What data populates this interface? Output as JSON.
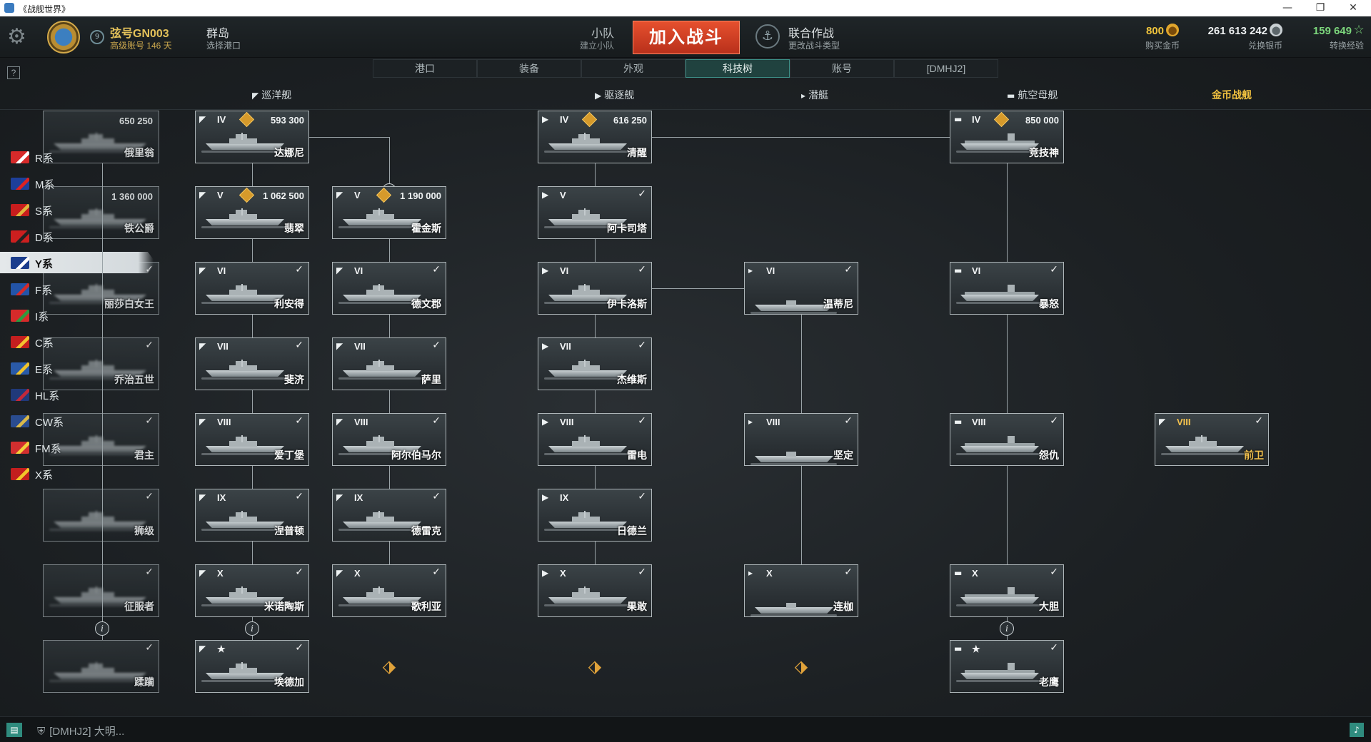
{
  "window": {
    "title": "《战舰世界》",
    "controls": [
      "—",
      "❐",
      "✕"
    ]
  },
  "header": {
    "player_name": "弦号GN003",
    "account_info": "高级账号 146 天",
    "port_name": "群岛",
    "port_sub": "选择港口",
    "division_label": "小队",
    "division_sub": "建立小队",
    "battle_button": "加入战斗",
    "ops_label": "联合作战",
    "ops_sub": "更改战斗类型",
    "gold_value": "800",
    "gold_label": "购买金币",
    "credits_value": "261 613 242",
    "credits_label": "兑换银币",
    "fxp_value": "159 649",
    "fxp_label": "转换经验"
  },
  "tabs": [
    {
      "label": "港口"
    },
    {
      "label": "装备"
    },
    {
      "label": "外观"
    },
    {
      "label": "科技树",
      "active": true
    },
    {
      "label": "账号"
    },
    {
      "label": "[DMHJ2]"
    }
  ],
  "help_label": "?",
  "class_headers": {
    "cruisers": "巡洋舰",
    "destroyers": "驱逐舰",
    "submarines": "潜艇",
    "carriers": "航空母舰",
    "premium": "金币战舰"
  },
  "nations": [
    {
      "label": "R系",
      "c1": "#d62a2a",
      "c2": "#ffffff"
    },
    {
      "label": "M系",
      "c1": "#1e3f9a",
      "c2": "#d22"
    },
    {
      "label": "S系",
      "c1": "#c81d1d",
      "c2": "#e0b53c"
    },
    {
      "label": "D系",
      "c1": "#cc1f1f",
      "c2": "#222"
    },
    {
      "label": "Y系",
      "c1": "#1b3d8c",
      "c2": "#ffffff",
      "active": true
    },
    {
      "label": "F系",
      "c1": "#2354a8",
      "c2": "#d42a2a"
    },
    {
      "label": "I系",
      "c1": "#d62a2a",
      "c2": "#2e9a3e"
    },
    {
      "label": "C系",
      "c1": "#c41f1f",
      "c2": "#f2c230"
    },
    {
      "label": "E系",
      "c1": "#2a5aa8",
      "c2": "#f0c32c"
    },
    {
      "label": "HL系",
      "c1": "#20397a",
      "c2": "#c2283a"
    },
    {
      "label": "CW系",
      "c1": "#2a4c8f",
      "c2": "#d9b84a"
    },
    {
      "label": "FM系",
      "c1": "#d22f2f",
      "c2": "#f4cf3a"
    },
    {
      "label": "X系",
      "c1": "#c31e1e",
      "c2": "#f2c52a"
    }
  ],
  "ghost_ships": [
    {
      "name": "俄里翁",
      "price": "650 250"
    },
    {
      "name": "铁公爵",
      "price": "1 360 000"
    },
    {
      "name": "丽莎白女王"
    },
    {
      "name": "乔治五世"
    },
    {
      "name": "君主"
    },
    {
      "name": "狮级"
    },
    {
      "name": "征服者"
    },
    {
      "name": "蹂躏"
    }
  ],
  "ships": [
    {
      "name": "达娜尼",
      "tier": "IV",
      "type": "cruiser",
      "price": "593 300"
    },
    {
      "name": "翡翠",
      "tier": "V",
      "type": "cruiser",
      "price": "1 062 500"
    },
    {
      "name": "霍金斯",
      "tier": "V",
      "type": "cruiser",
      "price": "1 190 000"
    },
    {
      "name": "利安得",
      "tier": "VI",
      "type": "cruiser"
    },
    {
      "name": "德文郡",
      "tier": "VI",
      "type": "cruiser"
    },
    {
      "name": "斐济",
      "tier": "VII",
      "type": "cruiser"
    },
    {
      "name": "萨里",
      "tier": "VII",
      "type": "cruiser"
    },
    {
      "name": "爱丁堡",
      "tier": "VIII",
      "type": "cruiser"
    },
    {
      "name": "阿尔伯马尔",
      "tier": "VIII",
      "type": "cruiser"
    },
    {
      "name": "涅普顿",
      "tier": "IX",
      "type": "cruiser"
    },
    {
      "name": "德雷克",
      "tier": "IX",
      "type": "cruiser"
    },
    {
      "name": "米诺陶斯",
      "tier": "X",
      "type": "cruiser"
    },
    {
      "name": "歌利亚",
      "tier": "X",
      "type": "cruiser"
    },
    {
      "name": "埃德加",
      "tier": "★",
      "type": "cruiser"
    },
    {
      "name": "清醒",
      "tier": "IV",
      "type": "destroyer",
      "price": "616 250"
    },
    {
      "name": "阿卡司塔",
      "tier": "V",
      "type": "destroyer"
    },
    {
      "name": "伊卡洛斯",
      "tier": "VI",
      "type": "destroyer"
    },
    {
      "name": "杰维斯",
      "tier": "VII",
      "type": "destroyer"
    },
    {
      "name": "雷电",
      "tier": "VIII",
      "type": "destroyer"
    },
    {
      "name": "日德兰",
      "tier": "IX",
      "type": "destroyer"
    },
    {
      "name": "果敢",
      "tier": "X",
      "type": "destroyer"
    },
    {
      "name": "温蒂尼",
      "tier": "VI",
      "type": "submarine"
    },
    {
      "name": "坚定",
      "tier": "VIII",
      "type": "submarine"
    },
    {
      "name": "连枷",
      "tier": "X",
      "type": "submarine"
    },
    {
      "name": "竞技神",
      "tier": "IV",
      "type": "carrier",
      "price": "850 000"
    },
    {
      "name": "暴怒",
      "tier": "VI",
      "type": "carrier"
    },
    {
      "name": "怨仇",
      "tier": "VIII",
      "type": "carrier"
    },
    {
      "name": "大胆",
      "tier": "X",
      "type": "carrier"
    },
    {
      "name": "老鹰",
      "tier": "★",
      "type": "carrier"
    },
    {
      "name": "前卫",
      "tier": "VIII",
      "type": "premium"
    }
  ],
  "footer": {
    "chat_icon": "chat-icon",
    "clan_text": "[DMHJ2]  大明..."
  },
  "colors": {
    "accent": "#e24a2a",
    "gold": "#e3c15a",
    "active_tab": "#3d8f87"
  }
}
